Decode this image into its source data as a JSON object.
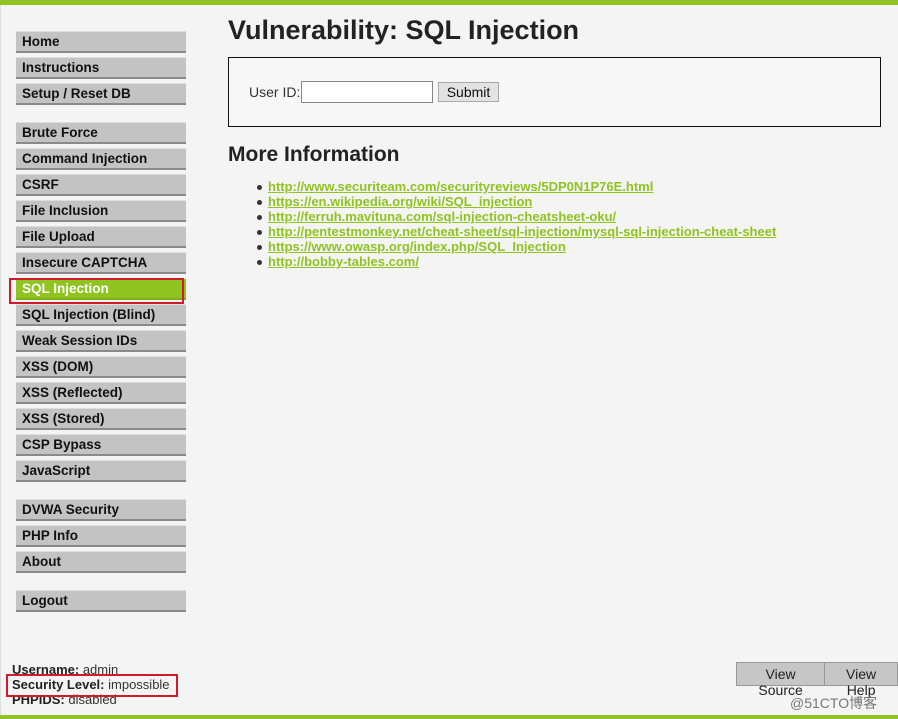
{
  "menu": {
    "groups": [
      {
        "items": [
          {
            "label": "Home"
          },
          {
            "label": "Instructions"
          },
          {
            "label": "Setup / Reset DB"
          }
        ]
      },
      {
        "items": [
          {
            "label": "Brute Force"
          },
          {
            "label": "Command Injection"
          },
          {
            "label": "CSRF"
          },
          {
            "label": "File Inclusion"
          },
          {
            "label": "File Upload"
          },
          {
            "label": "Insecure CAPTCHA"
          },
          {
            "label": "SQL Injection",
            "active": true
          },
          {
            "label": "SQL Injection (Blind)"
          },
          {
            "label": "Weak Session IDs"
          },
          {
            "label": "XSS (DOM)"
          },
          {
            "label": "XSS (Reflected)"
          },
          {
            "label": "XSS (Stored)"
          },
          {
            "label": "CSP Bypass"
          },
          {
            "label": "JavaScript"
          }
        ]
      },
      {
        "items": [
          {
            "label": "DVWA Security"
          },
          {
            "label": "PHP Info"
          },
          {
            "label": "About"
          }
        ]
      },
      {
        "items": [
          {
            "label": "Logout"
          }
        ]
      }
    ]
  },
  "main": {
    "title": "Vulnerability: SQL Injection",
    "form": {
      "user_id_label": "User ID:",
      "user_id_value": "",
      "submit_label": "Submit"
    },
    "more_info_title": "More Information",
    "links": [
      "http://www.securiteam.com/securityreviews/5DP0N1P76E.html",
      "https://en.wikipedia.org/wiki/SQL_injection",
      "http://ferruh.mavituna.com/sql-injection-cheatsheet-oku/",
      "http://pentestmonkey.net/cheat-sheet/sql-injection/mysql-sql-injection-cheat-sheet",
      "https://www.owasp.org/index.php/SQL_Injection",
      "http://bobby-tables.com/"
    ]
  },
  "status": {
    "username_label": "Username:",
    "username_value": "admin",
    "security_label": "Security Level:",
    "security_value": "impossible",
    "phpids_label": "PHPIDS:",
    "phpids_value": "disabled"
  },
  "footer": {
    "view_source": "View Source",
    "view_help": "View Help",
    "watermark": "@51CTO博客"
  },
  "colors": {
    "accent": "#8fc31f",
    "highlight_outline": "#d01c2a"
  }
}
